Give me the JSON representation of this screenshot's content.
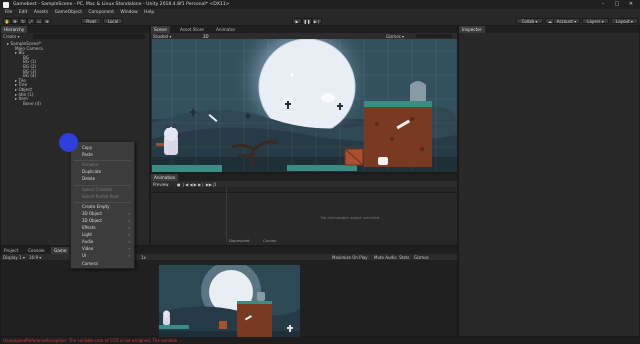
{
  "window": {
    "title": "Gamebest - SampleScene - PC, Mac & Linux Standalone - Unity 2018.4.8f1 Personal* <DX11>"
  },
  "menu": [
    "File",
    "Edit",
    "Assets",
    "GameObject",
    "Component",
    "Window",
    "Help"
  ],
  "toolbar": {
    "pivot": "Pivot",
    "local": "Local",
    "collab": "Collab",
    "account": "Account",
    "layers": "Layers",
    "layout": "Layout"
  },
  "hierarchy": {
    "tab": "Hierarchy",
    "create": "Create",
    "items": [
      {
        "label": "SampleScene*",
        "level": 0
      },
      {
        "label": "Main Camera",
        "level": 1
      },
      {
        "label": "BG",
        "level": 1
      },
      {
        "label": "BG",
        "level": 2
      },
      {
        "label": "BG (1)",
        "level": 2
      },
      {
        "label": "BG (2)",
        "level": 2
      },
      {
        "label": "BG (3)",
        "level": 2
      },
      {
        "label": "BG (4)",
        "level": 2
      },
      {
        "label": "Tile",
        "level": 1
      },
      {
        "label": "Tree",
        "level": 1
      },
      {
        "label": "Object",
        "level": 1
      },
      {
        "label": "Idle (1)",
        "level": 1
      },
      {
        "label": "Item",
        "level": 1
      },
      {
        "label": "Bone (4)",
        "level": 2
      }
    ]
  },
  "context_menu": {
    "items": [
      {
        "label": "Copy",
        "disabled": false
      },
      {
        "label": "Paste",
        "disabled": false
      },
      {
        "sep": true
      },
      {
        "label": "Rename",
        "disabled": true
      },
      {
        "label": "Duplicate",
        "disabled": false
      },
      {
        "label": "Delete",
        "disabled": false
      },
      {
        "sep": true
      },
      {
        "label": "Select Children",
        "disabled": true
      },
      {
        "label": "Select Prefab Root",
        "disabled": true
      },
      {
        "sep": true
      },
      {
        "label": "Create Empty",
        "disabled": false
      },
      {
        "label": "3D Object",
        "disabled": false,
        "submenu": true
      },
      {
        "label": "2D Object",
        "disabled": false,
        "submenu": true
      },
      {
        "label": "Effects",
        "disabled": false,
        "submenu": true
      },
      {
        "label": "Light",
        "disabled": false,
        "submenu": true
      },
      {
        "label": "Audio",
        "disabled": false,
        "submenu": true
      },
      {
        "label": "Video",
        "disabled": false,
        "submenu": true
      },
      {
        "label": "UI",
        "disabled": false,
        "submenu": true
      },
      {
        "label": "Camera",
        "disabled": false
      }
    ]
  },
  "scene": {
    "tabs": [
      "Scene",
      "Asset Store",
      "Animator"
    ],
    "shading": "Shaded",
    "mode": "2D",
    "gizmos": "Gizmos"
  },
  "animation": {
    "tab": "Animation",
    "preview": "Preview",
    "samples": "1",
    "empty_msg": "No animatable object selected.",
    "bottom_tabs": [
      "Dopesheet",
      "Curves"
    ]
  },
  "inspector": {
    "tab": "Inspector"
  },
  "bottom": {
    "tabs": [
      "Project",
      "Console",
      "Game"
    ],
    "display": "Display 1",
    "aspect": "16:9",
    "scale": "Scale",
    "scale_value": "1x",
    "options": [
      "Maximize On Play",
      "Mute Audio",
      "Stats",
      "Gizmos"
    ]
  },
  "status": {
    "error": "UnassignedReferenceException: The variable cam of CCD is not assigned. The variable ..."
  }
}
